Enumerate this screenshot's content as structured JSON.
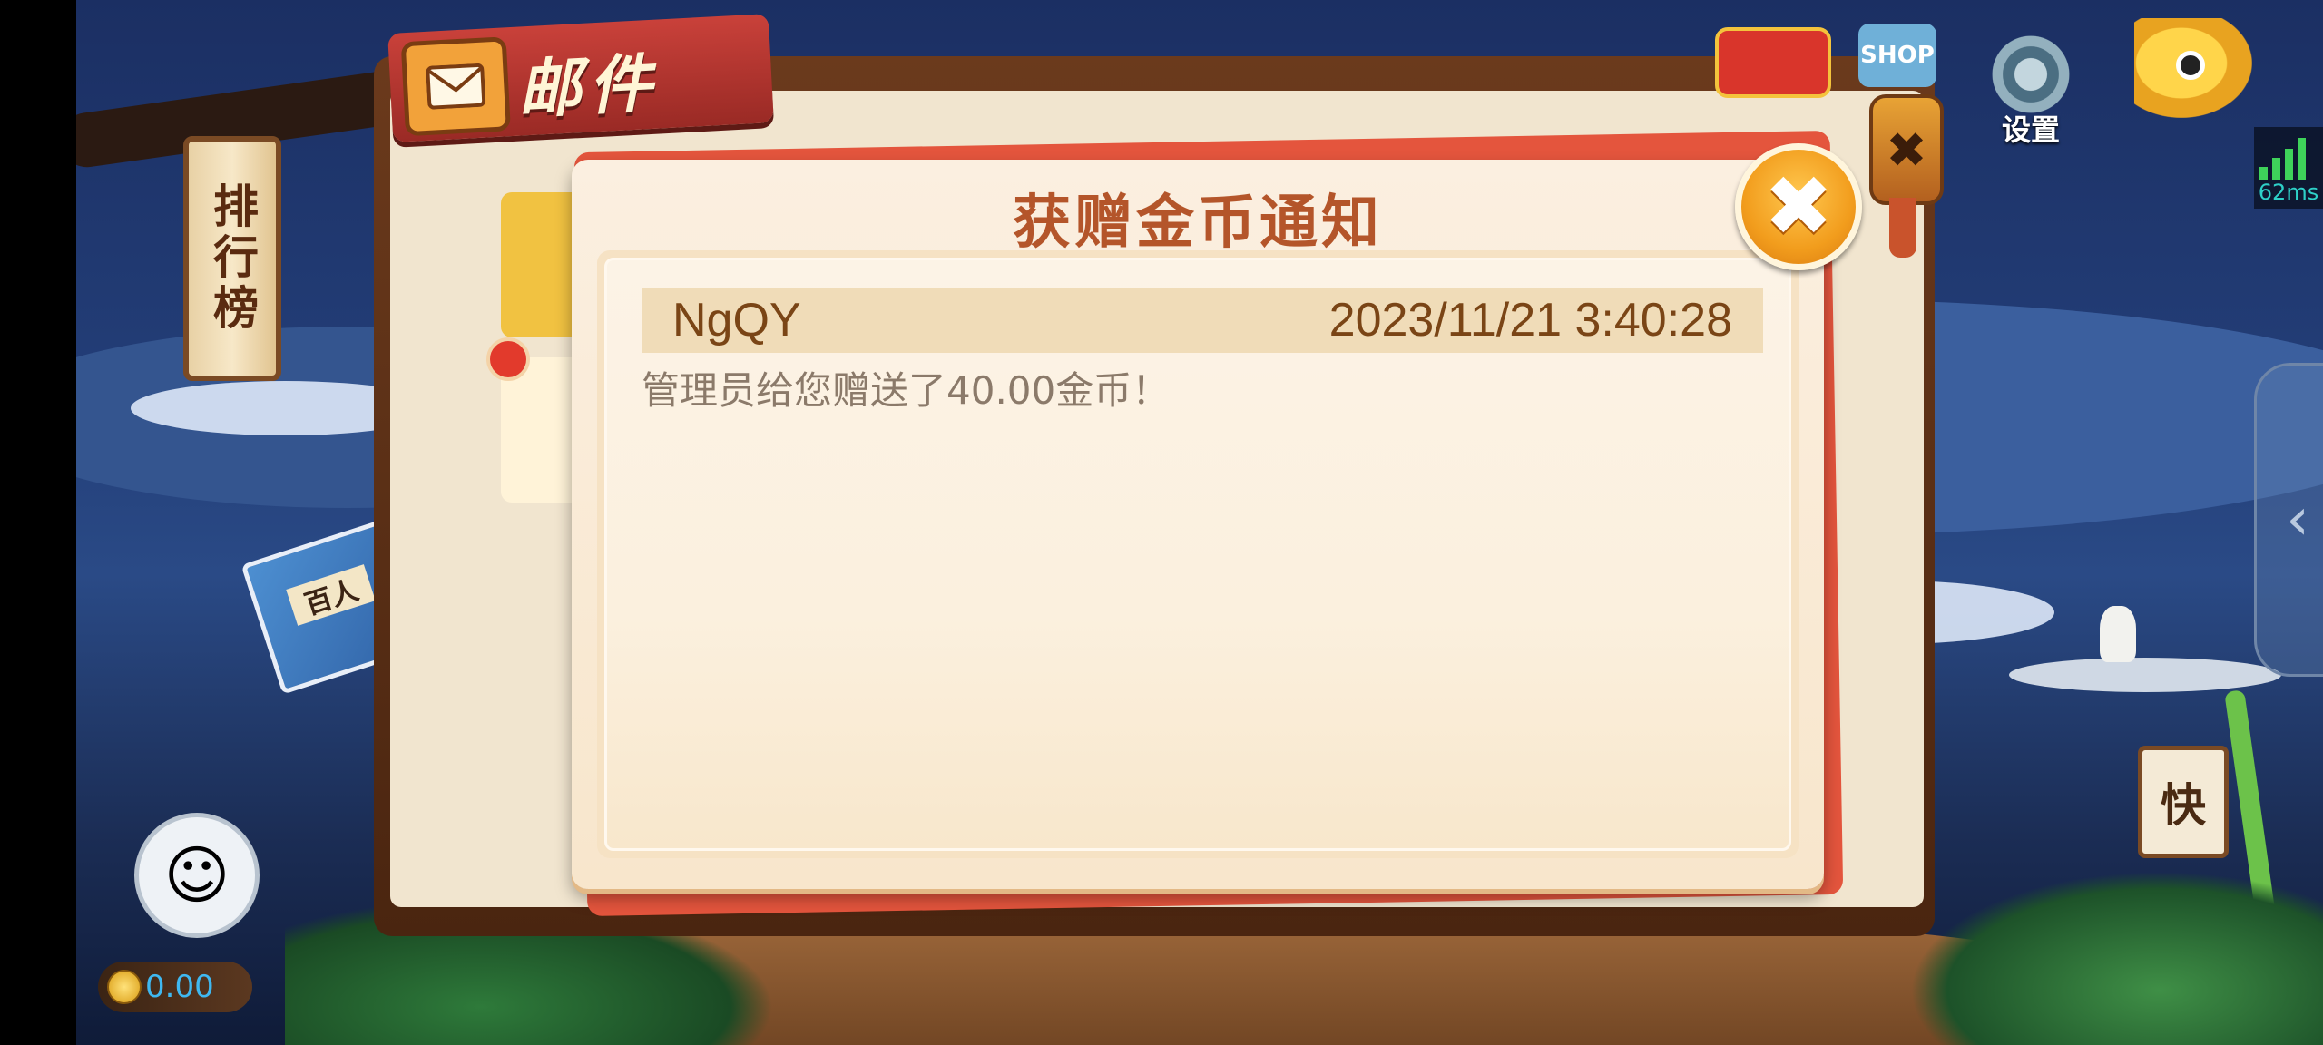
{
  "background": {
    "rank_sign": "排行榜",
    "book_label": "百人",
    "kuai_sign": "快"
  },
  "mail_panel": {
    "title": "邮件"
  },
  "hud": {
    "shop_label": "SHOP",
    "settings_label": "设置",
    "latency": "62ms",
    "close_glyph": "✖"
  },
  "player": {
    "coins": "0.00"
  },
  "dialog": {
    "title": "获赠金币通知",
    "message": {
      "sender": "NgQY",
      "time": "2023/11/21 3:40:28",
      "body": "管理员给您赠送了40.00金币！"
    }
  },
  "colors": {
    "title": "#b4552a",
    "row_bg": "#f0dcb8",
    "close_button": "#f29d1d",
    "mail_tab": "#c9413a",
    "latency": "#2ed0c8"
  },
  "icons": [
    "mail-icon",
    "gear-icon",
    "shop-icon",
    "gift-icon",
    "fish-icon",
    "signal-icon",
    "close-icon",
    "chevron-left-icon",
    "avatar-icon",
    "coin-icon"
  ]
}
